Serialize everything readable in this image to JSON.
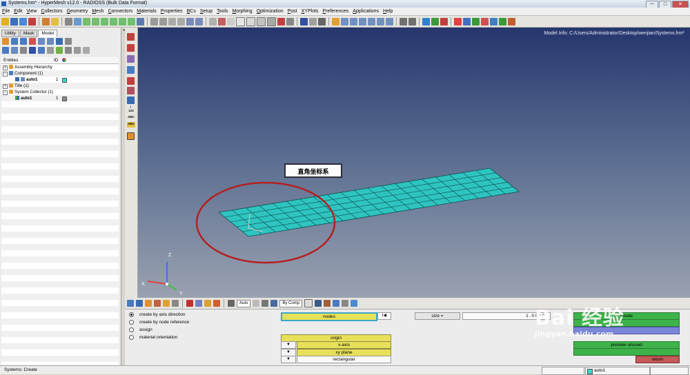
{
  "window": {
    "title": "Systems.hm* - HyperMesh v12.0 - RADIOSS (Bulk Data Format)",
    "minimize": "─",
    "maximize": "□",
    "close": "✕"
  },
  "menu": [
    "File",
    "Edit",
    "View",
    "Collectors",
    "Geometry",
    "Mesh",
    "Connectors",
    "Materials",
    "Properties",
    "BCs",
    "Setup",
    "Tools",
    "Morphing",
    "Optimization",
    "Post",
    "XYPlots",
    "Preferences",
    "Applications",
    "Help"
  ],
  "browser": {
    "tabs": [
      "Utility",
      "Mask",
      "Model"
    ],
    "active_tab": "Model",
    "close_glyph": "×",
    "columns": {
      "entities": "Entities",
      "id": "ID"
    },
    "tree": [
      {
        "label": "Assembly Hierarchy",
        "indent": 0,
        "expander": "+"
      },
      {
        "label": "Component (1)",
        "indent": 0,
        "expander": "−"
      },
      {
        "label": "auto1",
        "indent": 1,
        "id": "1",
        "color": "#35d6c8"
      },
      {
        "label": "Title (1)",
        "indent": 0,
        "expander": "+"
      },
      {
        "label": "System Collector (1)",
        "indent": 0,
        "expander": "−"
      },
      {
        "label": "auto1",
        "indent": 1,
        "id": "1",
        "color": "#8a8a8a"
      }
    ]
  },
  "viewport": {
    "model_info": "Model Info: C:/Users/Administrator/Desktop/wenjian/Systems.hm*",
    "annotation": "直角坐标系",
    "triad": {
      "x": "X",
      "y": "Y",
      "z": "Z"
    },
    "vbar_labels": {
      "l123": "123",
      "abc1": "ABC",
      "abc2": "ABC",
      "info": "i"
    }
  },
  "lower_toolbar": {
    "display_mode": "Auto",
    "color_mode": "By Comp"
  },
  "panel": {
    "options": [
      {
        "label": "create by axis direction",
        "selected": true
      },
      {
        "label": "create by node reference",
        "selected": false
      },
      {
        "label": "assign",
        "selected": false
      },
      {
        "label": "material orientation",
        "selected": false
      }
    ],
    "nodes_label": "nodes",
    "reset_glyph": "I◀",
    "origin_label": "origin",
    "x_axis_label": "x-axis",
    "xy_plane_label": "xy plane",
    "type_label": "rectangular",
    "dropdown_arrow": "▼",
    "size_label": "size =",
    "size_value": "1.0000",
    "create_label": "create",
    "preview_label": "preview unused",
    "return_label": "return"
  },
  "status": {
    "text": "Systems: Create",
    "component": "auto1"
  },
  "watermark": {
    "brand": "Bai 经验",
    "url": "jingyan.baidu.com"
  },
  "colors": {
    "mesh": "#2ec4c0",
    "mesh_edge": "#0d4a4a",
    "annotation_circle": "#b32020",
    "create_green": "#3db34a",
    "return_red": "#c55a5a"
  }
}
